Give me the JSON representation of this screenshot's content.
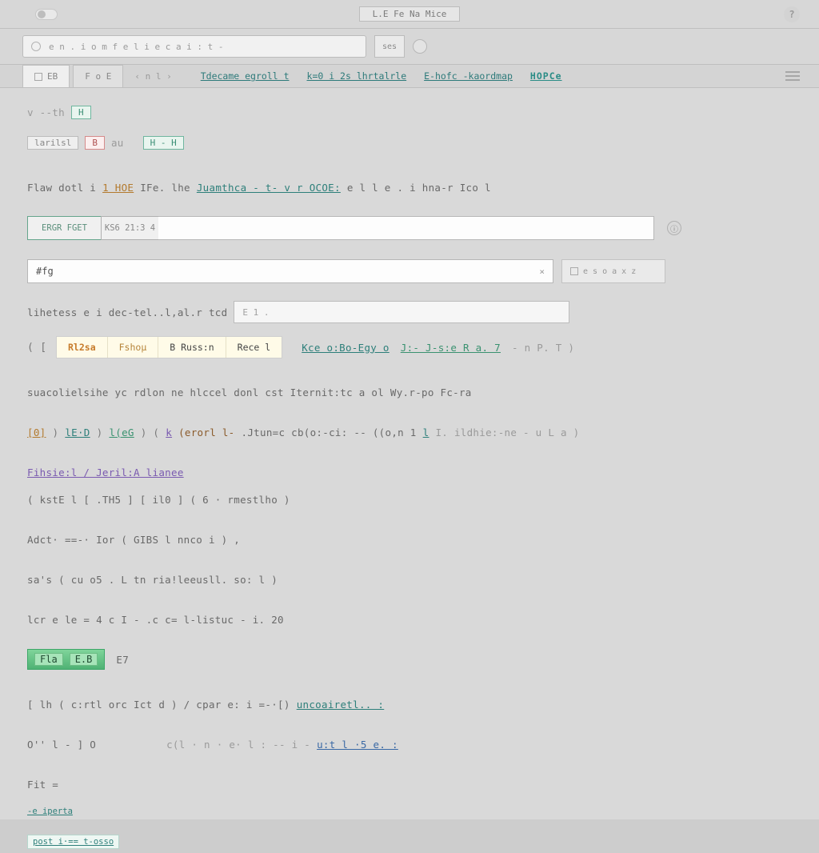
{
  "titlebar": {
    "title": "L.E Fe Na Mice",
    "help_glyph": "?"
  },
  "urlbar": {
    "text": "e n . i   o m f e l  i e c  a i : t -",
    "go_label": "ses"
  },
  "tabs": {
    "items": [
      {
        "label": "EB"
      },
      {
        "label": "F o E"
      },
      {
        "label": "‹  n  l  ›"
      }
    ],
    "header_links": [
      {
        "text": "Tdecame egroll  t",
        "cls": "link"
      },
      {
        "text": "k=0 i 2s  lhrtalrle",
        "cls": "link"
      },
      {
        "text": "E-hofc -kaordmap",
        "cls": "link"
      },
      {
        "text": "HOPCe",
        "cls": "link big"
      }
    ]
  },
  "lines": {
    "l1a": "v --th",
    "l1b": "H",
    "l2_tokens": [
      "larilsl",
      "B",
      "au",
      "H - H"
    ],
    "l3_prefix": "Flaw  dotl i",
    "l3_link": "1  HOE",
    "l3_mid": "IFe.    lhe",
    "l3_link2": "Juamthca - t- v  r OCOE:",
    "l3_tail": "e l l e . i hna-r Ico l",
    "searchA": {
      "tag1": "ERGR FGET",
      "tag2": "KS6 21:3 4",
      "info": "ⓘ"
    },
    "searchB": {
      "value": "#fg",
      "end": "×"
    },
    "aux_controls": "e s  o  a x  z",
    "path_label": "lihetess e i dec-tel..l,al.r   tcd",
    "file_box_text": "E 1 .",
    "tabs2": {
      "segs": [
        "Rl2sa",
        "Fshoμ",
        "B Russ:n",
        "Rece l"
      ],
      "rest_links": [
        "Kce o:Bo-Egy o",
        "J:- J-s:e R a. 7"
      ],
      "rest_tail": "-    n P. T  )"
    },
    "l6": "suacolielsihe  yc  rdlon  ne    hlccel  donl cst Iternit:tc a  ol Wy.r-po     Fc-ra",
    "l7_tokens": [
      "[0]",
      ")",
      "lE·D",
      ")",
      "l(eG",
      ") (",
      "k",
      "(erorl  l-",
      ".Jtun=c  cb(o:-ci: -- ((o,n 1",
      "l",
      "     I.  ildhie:-ne -    u       L  a  )"
    ],
    "l8a": "Fihsie:l / Jeril:A lianee",
    "l8b": "( kstE l [ .TH5 ] [ il0  ]   ( 6 ·   rmestlho )",
    "l9": "Adct· ==-·  Ior    ( GIBS  l  nnco i ) ,",
    "l10": "sa's    ( cu o5 .  L tn ria!leeusll. so: l )",
    "l11": "lcr e  le =   4 c I   - .c c=  l-listuc    -     i.      20",
    "l12_green": {
      "a": "Fla",
      "b": "E.B",
      "c": "E7"
    },
    "l13": "[ lh    ( c:rtl orc     Ict  d )  / cpar     e: i      =-·[)",
    "l13_link": "uncoairetl.. :",
    "l14a": "O'' l -  ] O",
    "l14b": "c(l · n · e· l     : --   i -",
    "l14c": "u:t    l ·5 e. :",
    "l15a": "Fit    =",
    "l15b": "-e    iperta",
    "l16": "post i·==  t-osso"
  }
}
